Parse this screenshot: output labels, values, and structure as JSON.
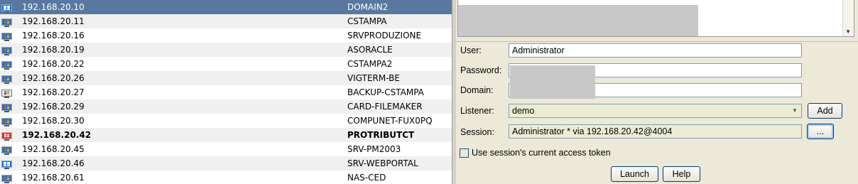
{
  "hosts": [
    {
      "ip": "192.168.20.10",
      "name": "DOMAIN2",
      "os": "windows-server-icon",
      "selected": true
    },
    {
      "ip": "192.168.20.11",
      "name": "CSTAMPA",
      "os": "windows-xp-icon"
    },
    {
      "ip": "192.168.20.16",
      "name": "SRVPRODUZIONE",
      "os": "windows-xp-icon"
    },
    {
      "ip": "192.168.20.19",
      "name": "ASORACLE",
      "os": "windows-xp-icon"
    },
    {
      "ip": "192.168.20.22",
      "name": "CSTAMPA2",
      "os": "windows-xp-icon"
    },
    {
      "ip": "192.168.20.26",
      "name": "VIGTERM-BE",
      "os": "windows-xp-icon"
    },
    {
      "ip": "192.168.20.27",
      "name": "BACKUP-CSTAMPA",
      "os": "windows-2000-icon"
    },
    {
      "ip": "192.168.20.29",
      "name": "CARD-FILEMAKER",
      "os": "windows-xp-icon"
    },
    {
      "ip": "192.168.20.30",
      "name": "COMPUNET-FUX0PQ",
      "os": "windows-xp-icon"
    },
    {
      "ip": "192.168.20.42",
      "name": "PROTRIBUTCT",
      "os": "compromised-host-icon",
      "bold": true
    },
    {
      "ip": "192.168.20.45",
      "name": "SRV-PM2003",
      "os": "windows-xp-icon"
    },
    {
      "ip": "192.168.20.46",
      "name": "SRV-WEBPORTAL",
      "os": "windows-server-icon"
    },
    {
      "ip": "192.168.20.61",
      "name": "NAS-CED",
      "os": "windows-xp-icon"
    }
  ],
  "form": {
    "user_label": "User:",
    "user_value": "Administrator",
    "password_label": "Password:",
    "password_value": "",
    "domain_label": "Domain:",
    "domain_value": "",
    "listener_label": "Listener:",
    "listener_value": "demo",
    "add_button": "Add",
    "session_label": "Session:",
    "session_value": "Administrator * via  192.168.20.42@4004",
    "browse_button": "...",
    "token_checkbox_label": "Use session's current access token",
    "token_checked": false,
    "launch_button": "Launch",
    "help_button": "Help"
  },
  "colors": {
    "selection": "#5878a0",
    "panel_bg": "#ece9d8",
    "button_border": "#003c74",
    "redaction": "#c8c8c8"
  }
}
